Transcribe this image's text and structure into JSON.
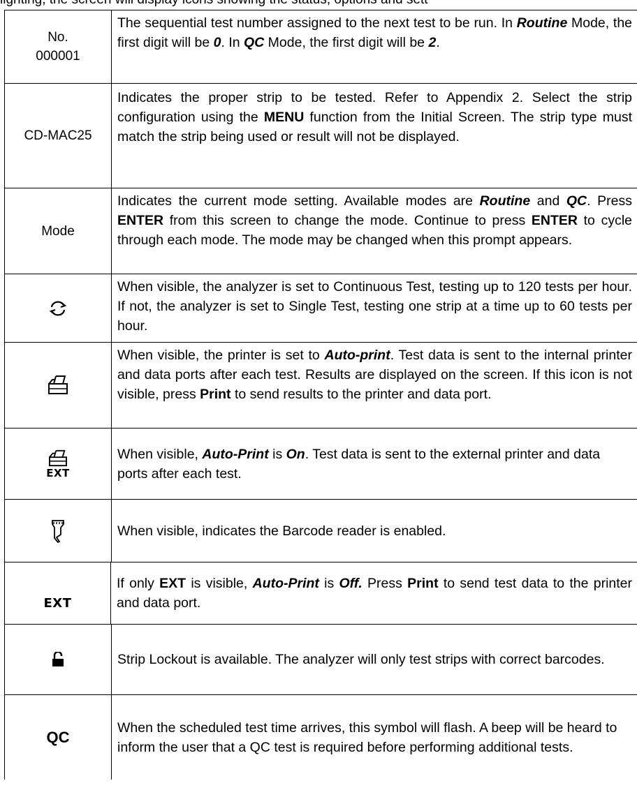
{
  "top_text": "lighting, the screen will display icons showing the status, options and sett",
  "rows": [
    {
      "label_line1": "No.",
      "label_line2": "000001",
      "desc": [
        {
          "t": "The sequential test number assigned to the next test to be run. In "
        },
        {
          "t": "Routine",
          "s": "bi"
        },
        {
          "t": " Mode, the first digit will be "
        },
        {
          "t": "0",
          "s": "bi"
        },
        {
          "t": ". In "
        },
        {
          "t": "QC",
          "s": "bi"
        },
        {
          "t": " Mode, the first digit will be "
        },
        {
          "t": "2",
          "s": "bi"
        },
        {
          "t": "."
        }
      ]
    },
    {
      "label": "CD-MAC25",
      "desc": [
        {
          "t": "Indicates the proper strip to be tested. Refer to Appendix 2. Select the strip configuration using the "
        },
        {
          "t": "MENU",
          "s": "b"
        },
        {
          "t": " function from the Initial Screen. The strip type must match the strip being used or result will not be displayed."
        }
      ]
    },
    {
      "label": "Mode",
      "desc": [
        {
          "t": "Indicates the current mode setting. Available modes are "
        },
        {
          "t": "Routine",
          "s": "bi"
        },
        {
          "t": " and "
        },
        {
          "t": "QC",
          "s": "bi"
        },
        {
          "t": ". Press "
        },
        {
          "t": "ENTER",
          "s": "b"
        },
        {
          "t": " from this screen to change the mode. Continue to press "
        },
        {
          "t": "ENTER",
          "s": "b"
        },
        {
          "t": " to cycle through each mode. The mode may be changed when this prompt appears."
        }
      ]
    },
    {
      "icon": "continuous-test-icon",
      "desc": [
        {
          "t": "When visible, the analyzer is set to Continuous Test, testing up to 120 tests per hour. If not, the analyzer is set to Single Test, testing one strip at a time up to 60 tests per hour."
        }
      ]
    },
    {
      "icon": "printer-icon",
      "desc": [
        {
          "t": "When visible, the printer is set to "
        },
        {
          "t": "Auto-print",
          "s": "bi"
        },
        {
          "t": ". Test data is sent to the internal printer and data ports after each test. Results are displayed on the screen. If this icon is not visible, press "
        },
        {
          "t": "Print",
          "s": "b"
        },
        {
          "t": " to send results to the printer and data port."
        }
      ]
    },
    {
      "icon": "external-printer-icon",
      "ext_label": "EXT",
      "desc": [
        {
          "t": "When visible, "
        },
        {
          "t": "Auto-Print",
          "s": "bi"
        },
        {
          "t": " is "
        },
        {
          "t": "On",
          "s": "bi"
        },
        {
          "t": ". Test data is sent to the external printer and data ports after each test."
        }
      ]
    },
    {
      "icon": "barcode-reader-icon",
      "desc": [
        {
          "t": "When visible, indicates the Barcode reader is enabled."
        }
      ]
    },
    {
      "icon": "ext-only-icon",
      "ext_label": "EXT",
      "desc": [
        {
          "t": "If only "
        },
        {
          "t": "EXT",
          "s": "b"
        },
        {
          "t": " is visible, "
        },
        {
          "t": "Auto-Print",
          "s": "bi"
        },
        {
          "t": " is "
        },
        {
          "t": "Off.",
          "s": "bi"
        },
        {
          "t": " Press "
        },
        {
          "t": "Print",
          "s": "b"
        },
        {
          "t": " to send test data to the printer and data port."
        }
      ]
    },
    {
      "icon": "unlocked-padlock-icon",
      "desc": [
        {
          "t": "Strip Lockout is available. The analyzer will only test strips with correct barcodes."
        }
      ]
    },
    {
      "label": "QC",
      "desc": [
        {
          "t": "When the scheduled test time arrives, this symbol will flash. A beep will be heard to inform the user that a QC test is required before performing additional tests."
        }
      ]
    }
  ]
}
